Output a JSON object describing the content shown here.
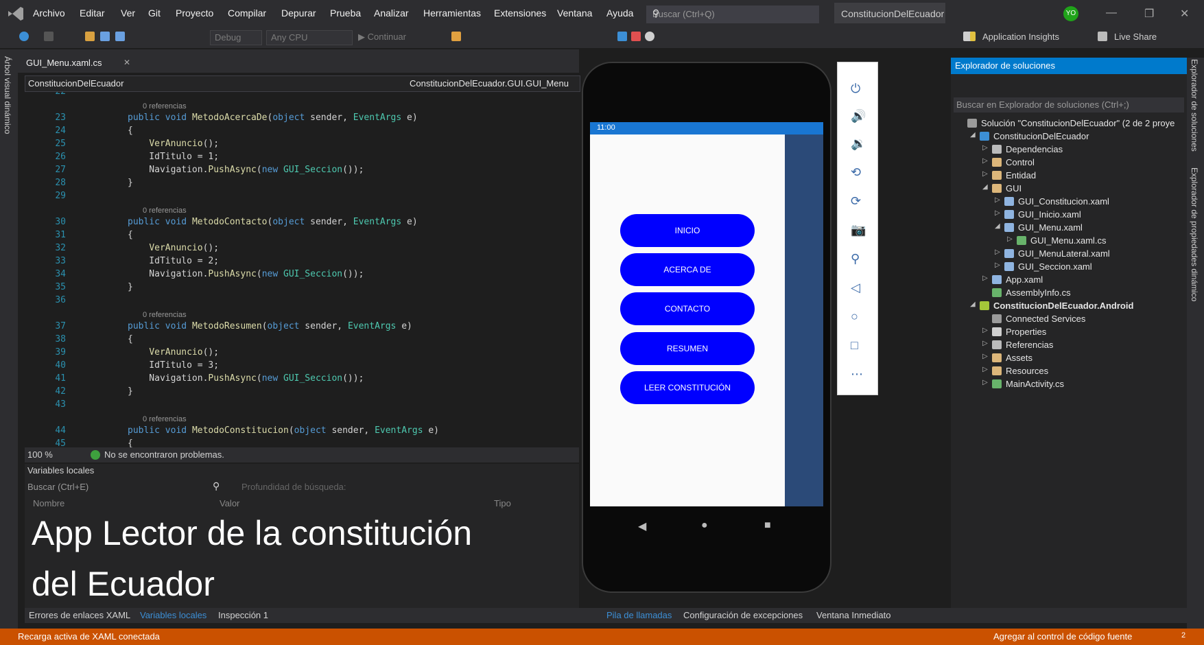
{
  "menu": {
    "items": [
      "Archivo",
      "Editar",
      "Ver",
      "Git",
      "Proyecto",
      "Compilar",
      "Depurar",
      "Prueba",
      "Analizar",
      "Herramientas",
      "Extensiones",
      "Ventana",
      "Ayuda"
    ],
    "search_placeholder": "Buscar (Ctrl+Q)",
    "project_name": "ConstitucionDelEcuador",
    "avatar": "YO",
    "minimize": "—",
    "maximize": "❐",
    "close": "✕"
  },
  "toolbar": {
    "config": "Debug",
    "platform": "Any CPU",
    "continue": "▶ Continuar",
    "insights": "Application Insights",
    "liveshare": "Live Share"
  },
  "left_tab": "Árbol visual dinámico",
  "editor": {
    "tab": "GUI_Menu.xaml.cs",
    "nav_left": "ConstitucionDelEcuador",
    "nav_right": "ConstitucionDelEcuador.GUI.GUI_Menu",
    "lines": [
      {
        "n": "22",
        "t": ""
      },
      {
        "n": "",
        "ref": "0 referencias"
      },
      {
        "n": "23",
        "t": "public void MetodoAcercaDe(object sender, EventArgs e)"
      },
      {
        "n": "24",
        "t": "{"
      },
      {
        "n": "25",
        "t": "    VerAnuncio();"
      },
      {
        "n": "26",
        "t": "    IdTitulo = 1;"
      },
      {
        "n": "27",
        "t": "    Navigation.PushAsync(new GUI_Seccion());"
      },
      {
        "n": "28",
        "t": "}"
      },
      {
        "n": "29",
        "t": ""
      },
      {
        "n": "",
        "ref": "0 referencias"
      },
      {
        "n": "30",
        "t": "public void MetodoContacto(object sender, EventArgs e)"
      },
      {
        "n": "31",
        "t": "{"
      },
      {
        "n": "32",
        "t": "    VerAnuncio();"
      },
      {
        "n": "33",
        "t": "    IdTitulo = 2;"
      },
      {
        "n": "34",
        "t": "    Navigation.PushAsync(new GUI_Seccion());"
      },
      {
        "n": "35",
        "t": "}"
      },
      {
        "n": "36",
        "t": ""
      },
      {
        "n": "",
        "ref": "0 referencias"
      },
      {
        "n": "37",
        "t": "public void MetodoResumen(object sender, EventArgs e)"
      },
      {
        "n": "38",
        "t": "{"
      },
      {
        "n": "39",
        "t": "    VerAnuncio();"
      },
      {
        "n": "40",
        "t": "    IdTitulo = 3;"
      },
      {
        "n": "41",
        "t": "    Navigation.PushAsync(new GUI_Seccion());"
      },
      {
        "n": "42",
        "t": "}"
      },
      {
        "n": "43",
        "t": ""
      },
      {
        "n": "",
        "ref": "0 referencias"
      },
      {
        "n": "44",
        "t": "public void MetodoConstitucion(object sender, EventArgs e)"
      },
      {
        "n": "45",
        "t": "{"
      }
    ],
    "zoom": "100 %",
    "problems": "No se encontraron problemas."
  },
  "locals": {
    "title": "Variables locales",
    "search": "Buscar (Ctrl+E)",
    "depth": "Profundidad de búsqueda:",
    "col_name": "Nombre",
    "col_value": "Valor",
    "col_type": "Tipo"
  },
  "overlay": [
    "App Lector de la constitución",
    "del Ecuador"
  ],
  "bottom_tabs_left": [
    "Errores de enlaces XAML",
    "Variables locales",
    "Inspección 1"
  ],
  "bottom_tabs_right": [
    "Pila de llamadas",
    "Configuración de excepciones",
    "Ventana Inmediato"
  ],
  "status": {
    "left": "Recarga activa de XAML conectada",
    "right": "Agregar al control de código fuente",
    "badge": "2"
  },
  "phone": {
    "time": "11:00",
    "buttons": [
      "INICIO",
      "ACERCA DE",
      "CONTACTO",
      "RESUMEN",
      "LEER CONSTITUCIÓN"
    ]
  },
  "solution": {
    "title": "Explorador de soluciones",
    "search": "Buscar en Explorador de soluciones (Ctrl+;)",
    "items": [
      {
        "label": "Solución \"ConstitucionDelEcuador\" (2 de 2 proye",
        "indent": 0,
        "arrow": "",
        "icon": "solution-icon",
        "bold": false
      },
      {
        "label": "ConstitucionDelEcuador",
        "indent": 1,
        "arrow": "◢",
        "icon": "csproj-icon",
        "bold": false
      },
      {
        "label": "Dependencias",
        "indent": 2,
        "arrow": "▷",
        "icon": "dependencies-icon",
        "bold": false
      },
      {
        "label": "Control",
        "indent": 2,
        "arrow": "▷",
        "icon": "folder-icon",
        "bold": false
      },
      {
        "label": "Entidad",
        "indent": 2,
        "arrow": "▷",
        "icon": "folder-icon",
        "bold": false
      },
      {
        "label": "GUI",
        "indent": 2,
        "arrow": "◢",
        "icon": "folder-open-icon",
        "bold": false
      },
      {
        "label": "GUI_Constitucion.xaml",
        "indent": 3,
        "arrow": "▷",
        "icon": "xaml-icon",
        "bold": false
      },
      {
        "label": "GUI_Inicio.xaml",
        "indent": 3,
        "arrow": "▷",
        "icon": "xaml-icon",
        "bold": false
      },
      {
        "label": "GUI_Menu.xaml",
        "indent": 3,
        "arrow": "◢",
        "icon": "xaml-icon",
        "bold": false
      },
      {
        "label": "GUI_Menu.xaml.cs",
        "indent": 4,
        "arrow": "▷",
        "icon": "cs-icon",
        "bold": false
      },
      {
        "label": "GUI_MenuLateral.xaml",
        "indent": 3,
        "arrow": "▷",
        "icon": "xaml-icon",
        "bold": false
      },
      {
        "label": "GUI_Seccion.xaml",
        "indent": 3,
        "arrow": "▷",
        "icon": "xaml-icon",
        "bold": false
      },
      {
        "label": "App.xaml",
        "indent": 2,
        "arrow": "▷",
        "icon": "xaml-icon",
        "bold": false
      },
      {
        "label": "AssemblyInfo.cs",
        "indent": 2,
        "arrow": "",
        "icon": "cs-icon",
        "bold": false
      },
      {
        "label": "ConstitucionDelEcuador.Android",
        "indent": 1,
        "arrow": "◢",
        "icon": "android-icon",
        "bold": true
      },
      {
        "label": "Connected Services",
        "indent": 2,
        "arrow": "",
        "icon": "connected-services-icon",
        "bold": false
      },
      {
        "label": "Properties",
        "indent": 2,
        "arrow": "▷",
        "icon": "wrench-icon",
        "bold": false
      },
      {
        "label": "Referencias",
        "indent": 2,
        "arrow": "▷",
        "icon": "dependencies-icon",
        "bold": false
      },
      {
        "label": "Assets",
        "indent": 2,
        "arrow": "▷",
        "icon": "folder-icon",
        "bold": false
      },
      {
        "label": "Resources",
        "indent": 2,
        "arrow": "▷",
        "icon": "folder-icon",
        "bold": false
      },
      {
        "label": "MainActivity.cs",
        "indent": 2,
        "arrow": "▷",
        "icon": "cs-icon",
        "bold": false
      }
    ]
  },
  "right_tabs": [
    "Explorador de soluciones",
    "Explorador de propiedades dinámico"
  ],
  "colors": {
    "accent": "#007acc",
    "status": "#ca5100",
    "button": "#0000ff",
    "editor_bg": "#1e1e1e"
  }
}
